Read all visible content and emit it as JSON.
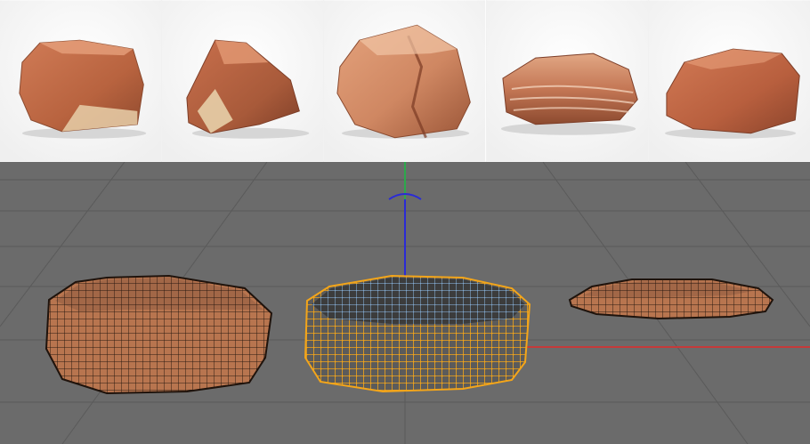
{
  "thumbnails": [
    {
      "name": "rock-thumbnail-1",
      "icon": "sandstone-rock-1"
    },
    {
      "name": "rock-thumbnail-2",
      "icon": "sandstone-rock-2"
    },
    {
      "name": "rock-thumbnail-3",
      "icon": "sandstone-rock-3"
    },
    {
      "name": "rock-thumbnail-4",
      "icon": "sandstone-rock-4"
    },
    {
      "name": "rock-thumbnail-5",
      "icon": "sandstone-rock-5"
    }
  ],
  "viewport": {
    "background_color": "#6b6b6b",
    "grid_color": "#5a5a5a",
    "y_axis_color": "#2b2bd6",
    "x_axis_color": "#c53a3a",
    "z_axis_color": "#2da84b",
    "meshes": [
      {
        "name": "left-rock-mesh",
        "wire_color": "#2a1a10",
        "fill_color": "#b8754f"
      },
      {
        "name": "middle-rock-mesh-selected",
        "wire_color": "#f3a51a",
        "top_color": "#7aa8d8"
      },
      {
        "name": "right-rock-mesh",
        "wire_color": "#2a1a10",
        "fill_color": "#b8754f"
      }
    ]
  }
}
